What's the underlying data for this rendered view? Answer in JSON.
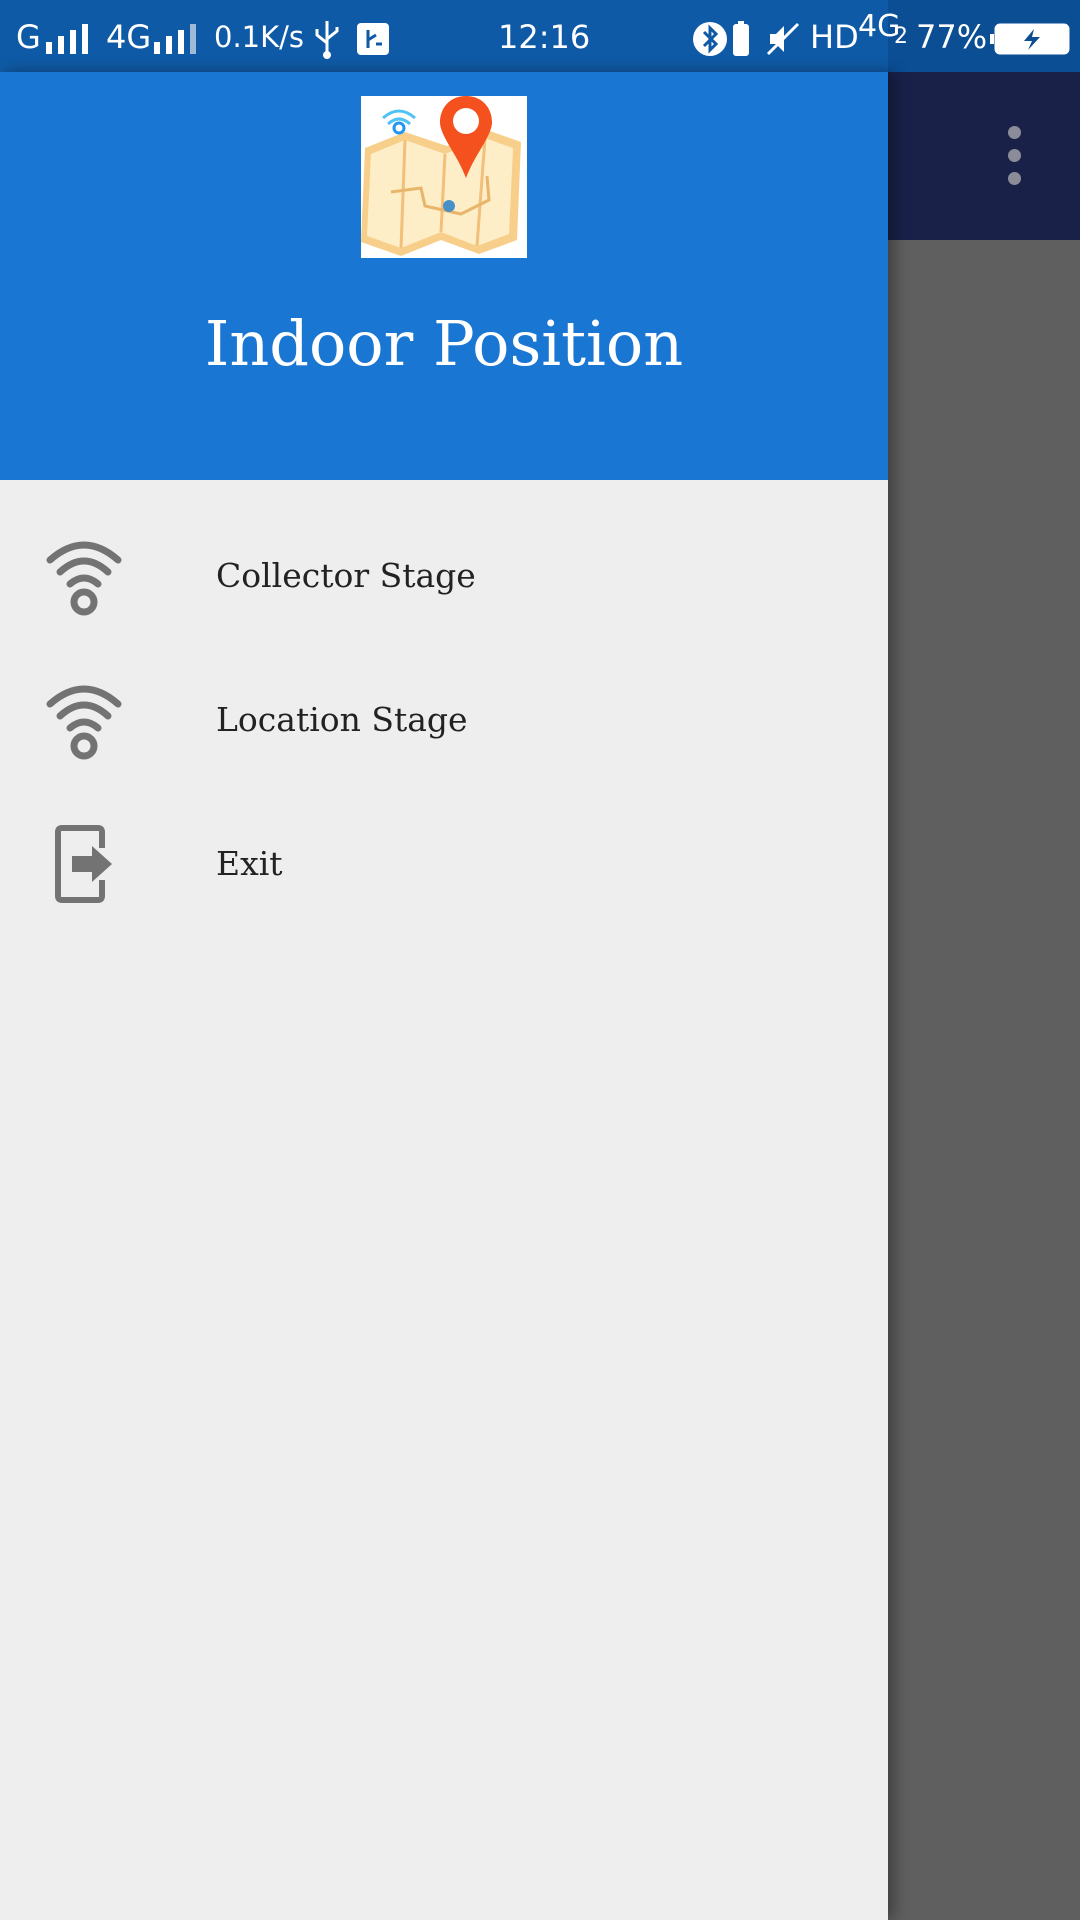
{
  "status_bar": {
    "carrier1": "G",
    "network2": "4G",
    "net_speed": "0.1K/s",
    "time": "12:16",
    "hd": "HD",
    "lte": "4G",
    "sim2": "2",
    "battery": "77%"
  },
  "app": {
    "title": "Indoor Position"
  },
  "drawer": {
    "items": [
      {
        "label": "Collector Stage",
        "icon": "wifi-icon"
      },
      {
        "label": "Location Stage",
        "icon": "wifi-icon"
      },
      {
        "label": "Exit",
        "icon": "exit-icon"
      }
    ]
  },
  "colors": {
    "header": "#1976d2",
    "status_bar": "#0f5aa6",
    "drawer_bg": "#eeeeee",
    "scrim": "#5f5f5f",
    "icon": "#737373",
    "pin": "#f4511e"
  }
}
